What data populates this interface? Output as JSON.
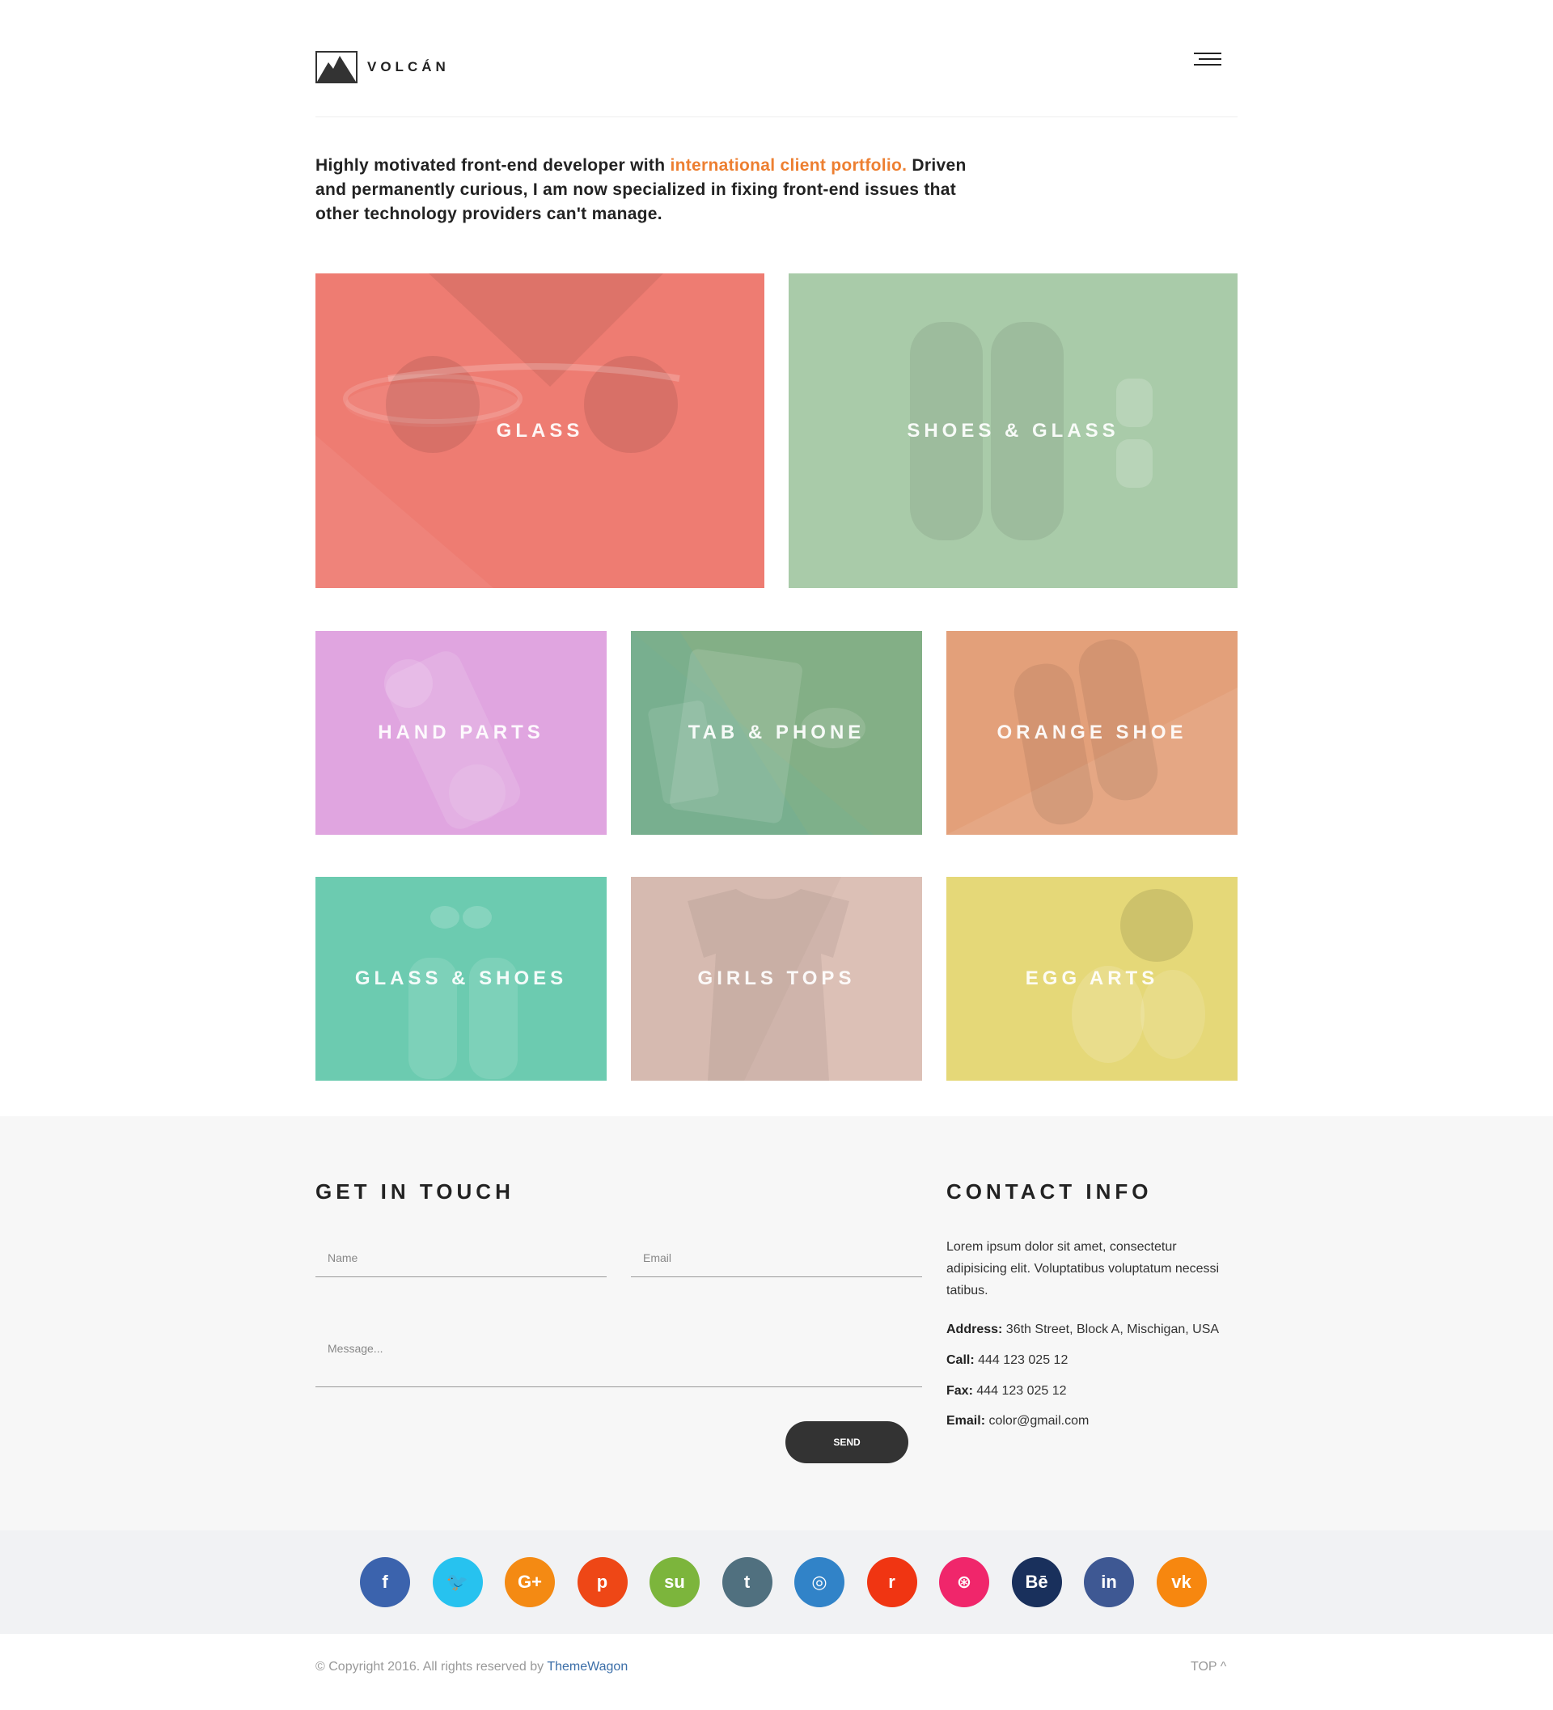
{
  "header": {
    "brand": "VOLCÁN"
  },
  "intro": {
    "part1": "Highly motivated front-end developer with ",
    "highlight": "international client portfolio.",
    "part2": " Driven and permanently curious, I am now specialized in fixing front-end issues that other technology providers can't manage."
  },
  "portfolio": {
    "tiles": [
      {
        "label": "GLASS",
        "color": "#ee7c72"
      },
      {
        "label": "SHOES & GLASS",
        "color": "#a9cba9"
      },
      {
        "label": "HAND PARTS",
        "color": "#e0a5e0"
      },
      {
        "label": "TAB & PHONE",
        "color": "#7eb08a"
      },
      {
        "label": "ORANGE SHOE",
        "color": "#e3a07a"
      },
      {
        "label": "GLASS & SHOES",
        "color": "#6ccbb0"
      },
      {
        "label": "GIRLS TOPS",
        "color": "#d6bab0"
      },
      {
        "label": "EGG ARTS",
        "color": "#e5d878"
      }
    ]
  },
  "contact": {
    "form_title": "GET IN TOUCH",
    "name_placeholder": "Name",
    "email_placeholder": "Email",
    "message_placeholder": "Message...",
    "send_label": "SEND",
    "info_title": "CONTACT INFO",
    "info_text": "Lorem ipsum dolor sit amet, consectetur adipisicing elit. Voluptatibus voluptatum necessi tatibus.",
    "address_label": "Address:",
    "address_value": " 36th Street, Block A, Mischigan, USA",
    "call_label": "Call:",
    "call_value": " 444 123 025 12",
    "fax_label": "Fax:",
    "fax_value": " 444 123 025 12",
    "email_label": "Email:",
    "email_value": " color@gmail.com"
  },
  "social": [
    {
      "name": "facebook-icon",
      "glyph": "f",
      "color": "#3b63ad"
    },
    {
      "name": "twitter-icon",
      "glyph": "🐦",
      "color": "#27c2ef"
    },
    {
      "name": "google-plus-icon",
      "glyph": "G+",
      "color": "#f48a13"
    },
    {
      "name": "pinterest-icon",
      "glyph": "p",
      "color": "#ee4716"
    },
    {
      "name": "stumbleupon-icon",
      "glyph": "su",
      "color": "#7cb53c"
    },
    {
      "name": "tumblr-icon",
      "glyph": "t",
      "color": "#50707f"
    },
    {
      "name": "instagram-icon",
      "glyph": "◎",
      "color": "#3183c8"
    },
    {
      "name": "reddit-icon",
      "glyph": "r",
      "color": "#f03512"
    },
    {
      "name": "dribbble-icon",
      "glyph": "⊛",
      "color": "#f0266b"
    },
    {
      "name": "behance-icon",
      "glyph": "Bē",
      "color": "#19305c"
    },
    {
      "name": "linkedin-icon",
      "glyph": "in",
      "color": "#3e5893"
    },
    {
      "name": "vk-icon",
      "glyph": "vk",
      "color": "#f7870f"
    }
  ],
  "footer": {
    "copyright": "© Copyright 2016. All rights reserved by ",
    "credit": "ThemeWagon",
    "top_label": "TOP ^"
  }
}
